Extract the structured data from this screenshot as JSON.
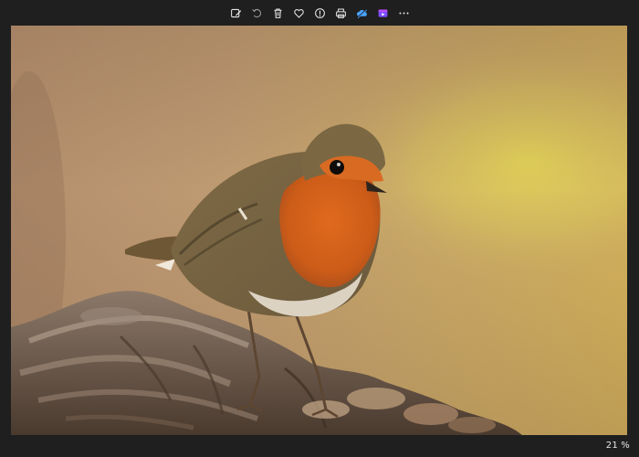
{
  "toolbar": {
    "buttons": [
      {
        "name": "edit-image-button",
        "icon": "edit-image-icon"
      },
      {
        "name": "rotate-button",
        "icon": "rotate-icon"
      },
      {
        "name": "delete-button",
        "icon": "trash-icon"
      },
      {
        "name": "favorite-button",
        "icon": "heart-icon"
      },
      {
        "name": "file-info-button",
        "icon": "info-icon"
      },
      {
        "name": "print-button",
        "icon": "printer-icon"
      },
      {
        "name": "onedrive-button",
        "icon": "cloud-icon"
      },
      {
        "name": "video-editor-button",
        "icon": "clipchamp-icon"
      },
      {
        "name": "more-options-button",
        "icon": "more-icon"
      }
    ]
  },
  "image": {
    "subject": "bird-photo"
  },
  "status": {
    "zoom": "21 %"
  },
  "colors": {
    "chrome": "#1f1f1f",
    "icon": "#e6e6e6",
    "cloud_accent": "#4aa3ff",
    "clipchamp_accent": "#7b4dff"
  }
}
